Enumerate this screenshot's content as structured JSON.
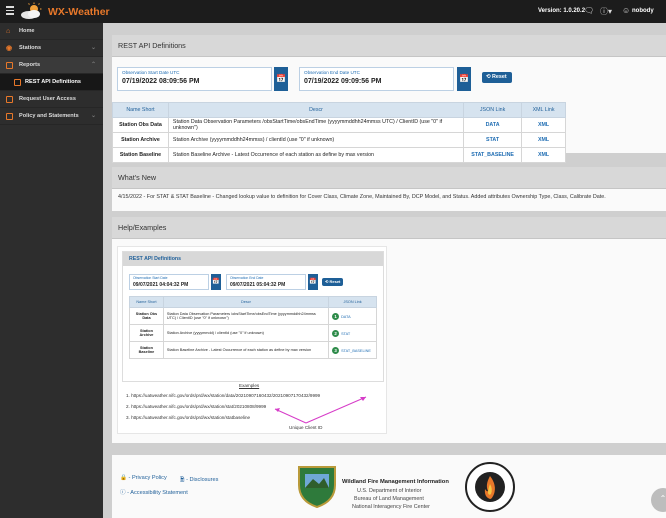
{
  "app": {
    "title": "WX-Weather",
    "version": "Version: 1.0.20.2",
    "user": "nobody"
  },
  "icons": {
    "menu": "hamburger-icon",
    "logo": "sun-cloud-logo",
    "chat": "chat-icon",
    "help": "help-icon",
    "user": "user-icon"
  },
  "colors": {
    "accent": "#e8782a",
    "topbar": "#1c1c1c",
    "sidebar": "#2d2d2d",
    "primary": "#1e5f97",
    "link": "#1f6db3"
  },
  "sidebar": {
    "items": [
      {
        "label": "Home"
      },
      {
        "label": "Stations"
      },
      {
        "label": "Reports"
      },
      {
        "label": "REST API Definitions"
      },
      {
        "label": "Request User Access"
      },
      {
        "label": "Policy and Statements"
      }
    ]
  },
  "api": {
    "title": "REST API Definitions",
    "start_label": "Observation Start Date UTC",
    "start_value": "07/19/2022 08:09:56 PM",
    "end_label": "Observation End Date UTC",
    "end_value": "07/19/2022 09:09:56 PM",
    "reset_label": "Reset",
    "columns": {
      "name": "Name Short",
      "descr": "Descr",
      "json": "JSON Link",
      "xml": "XML Link"
    },
    "rows": [
      {
        "name": "Station Obs Data",
        "descr": "Station Data Observation Parameters /obsStartTime/obsEndTime (yyyymmddhh24mmss UTC) / ClientID (use \"0\" if unknown\")",
        "json": "DATA",
        "xml": "XML"
      },
      {
        "name": "Station Archive",
        "descr": "Station Archive (yyyymmddhh24mmss) / clientId (use \"0\" if unknown)",
        "json": "STAT",
        "xml": "XML"
      },
      {
        "name": "Station Baseline",
        "descr": "Station Baseline Archive - Latest Occurrence of each station as define by max version",
        "json": "STAT_BASELINE",
        "xml": "XML"
      }
    ]
  },
  "whats_new": {
    "title": "What's New",
    "text": "4/15/2022 - For STAT & STAT Baseline - Changed lookup value to definition for Cover Class, Climate Zone, Maintained By, DCP Model, and Status. Added attributes Ownership Type, Class, Calibrate Date."
  },
  "help": {
    "title": "Help/Examples",
    "example": {
      "title": "REST API Definitions",
      "start_label": "Observation Start Date",
      "start_value": "09/07/2021 04:04:32 PM",
      "end_label": "Observation End Date",
      "end_value": "09/07/2021 05:04:32 PM",
      "reset_label": "Reset",
      "columns": {
        "name": "Name Short",
        "descr": "Descr",
        "json": "JSON Link"
      },
      "rows": [
        {
          "name": "Station Obs Data",
          "descr": "Station Data Observation Parameters /obsStartTime/obsEndTime (yyyymmddhh24mmss UTC) / ClientID (use \"0\" if unknown\")",
          "num": "1",
          "json": "DATA"
        },
        {
          "name": "Station Archive",
          "descr": "Station Archive (yyyymmdd) / clientId (use \"0\" if unknown)",
          "num": "2",
          "json": "STAT"
        },
        {
          "name": "Station Baseline",
          "descr": "Station Baseline Archive - Latest Occurrence of each station as define by max version",
          "num": "3",
          "json": "STAT_BASELINE"
        }
      ],
      "caption": "Examples",
      "urls": [
        "1. https://uatweather.nifc.gov/ords/prd/wx/station/data/20210907160432/20210907170432/9999",
        "2. https://uatweather.nifc.gov/ords/prd/wx/station/stat/20210808/9999",
        "3. https://uatweather.nifc.gov/ords/prd/wx/station/statbaseline"
      ],
      "note": "Unique Client ID"
    }
  },
  "footer": {
    "privacy": "- Privacy Policy",
    "disclosures": "- Disclosures",
    "accessibility": "- Accessibility Statement",
    "org_title": "Wildland Fire Management Information",
    "org_lines": [
      "U.S. Department of Interior",
      "Bureau of Land Management",
      "National Interagency Fire Center"
    ]
  }
}
